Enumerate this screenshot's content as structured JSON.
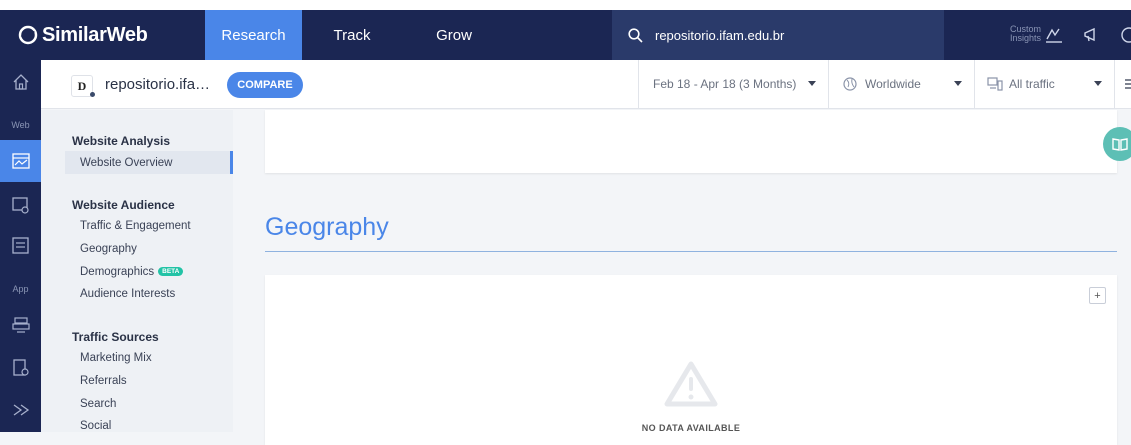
{
  "topbar": {
    "logo": "SimilarWeb",
    "tabs": [
      "Research",
      "Track",
      "Grow"
    ],
    "search_value": "repositorio.ifam.edu.br",
    "custom_insights": [
      "Custom",
      "Insights"
    ]
  },
  "rail": {
    "labels": [
      "Web",
      "App"
    ]
  },
  "subheader": {
    "favicon_letter": "D",
    "site_name": "repositorio.ifa…",
    "compare_label": "COMPARE",
    "date_filter": "Feb 18 - Apr 18 (3 Months)",
    "geo_filter": "Worldwide",
    "traffic_filter": "All traffic"
  },
  "sidenav": {
    "sections": [
      {
        "heading": "Website Analysis",
        "items": [
          "Website Overview"
        ]
      },
      {
        "heading": "Website Audience",
        "items": [
          "Traffic & Engagement",
          "Geography",
          "Demographics",
          "Audience Interests"
        ]
      },
      {
        "heading": "Traffic Sources",
        "items": [
          "Marketing Mix",
          "Referrals",
          "Search",
          "Social"
        ]
      }
    ],
    "beta_badge": "BETA"
  },
  "main": {
    "section_title": "Geography",
    "plus_label": "+",
    "no_data": "NO DATA AVAILABLE"
  },
  "colors": {
    "topbar": "#1b2653",
    "accent": "#4a86e8",
    "teal": "#22c3a6"
  }
}
